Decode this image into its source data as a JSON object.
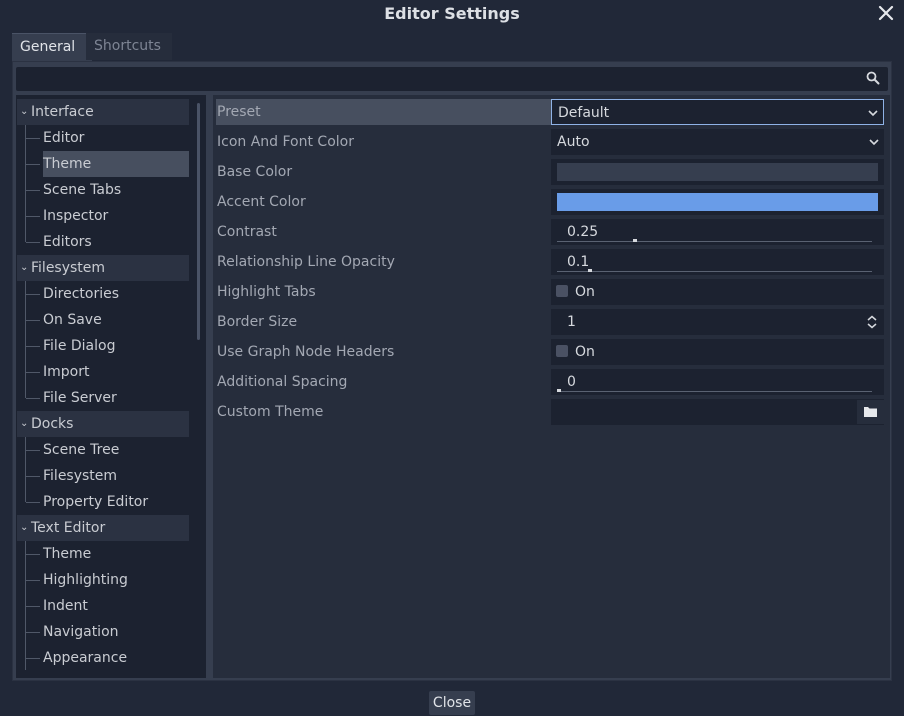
{
  "window": {
    "title": "Editor Settings"
  },
  "tabs": [
    {
      "label": "General",
      "active": true
    },
    {
      "label": "Shortcuts",
      "active": false
    }
  ],
  "search": {
    "value": "",
    "placeholder": ""
  },
  "tree": {
    "sections": [
      {
        "label": "Interface",
        "children": [
          "Editor",
          "Theme",
          "Scene Tabs",
          "Inspector",
          "Editors"
        ]
      },
      {
        "label": "Filesystem",
        "children": [
          "Directories",
          "On Save",
          "File Dialog",
          "Import",
          "File Server"
        ]
      },
      {
        "label": "Docks",
        "children": [
          "Scene Tree",
          "Filesystem",
          "Property Editor"
        ]
      },
      {
        "label": "Text Editor",
        "children": [
          "Theme",
          "Highlighting",
          "Indent",
          "Navigation",
          "Appearance"
        ]
      }
    ],
    "selected": "Theme"
  },
  "properties": {
    "preset": {
      "label": "Preset",
      "value": "Default"
    },
    "icon_font_color": {
      "label": "Icon And Font Color",
      "value": "Auto"
    },
    "base_color": {
      "label": "Base Color",
      "color": "#363e4f"
    },
    "accent_color": {
      "label": "Accent Color",
      "color": "#699ce8"
    },
    "contrast": {
      "label": "Contrast",
      "value": "0.25"
    },
    "relationship_line_opacity": {
      "label": "Relationship Line Opacity",
      "value": "0.1"
    },
    "highlight_tabs": {
      "label": "Highlight Tabs",
      "value": "On"
    },
    "border_size": {
      "label": "Border Size",
      "value": "1"
    },
    "graph_node_headers": {
      "label": "Use Graph Node Headers",
      "value": "On"
    },
    "additional_spacing": {
      "label": "Additional Spacing",
      "value": "0"
    },
    "custom_theme": {
      "label": "Custom Theme",
      "value": ""
    }
  },
  "footer": {
    "close_label": "Close"
  },
  "icons": [
    "close-icon",
    "search-icon",
    "chevron-down-icon",
    "updown-arrows-icon",
    "folder-icon"
  ]
}
